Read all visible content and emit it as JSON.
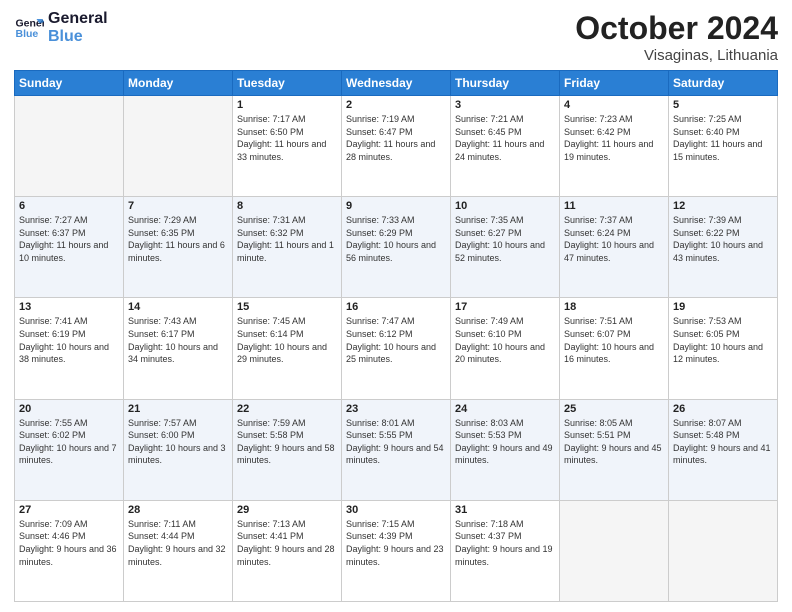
{
  "logo": {
    "line1": "General",
    "line2": "Blue"
  },
  "title": "October 2024",
  "location": "Visaginas, Lithuania",
  "days_header": [
    "Sunday",
    "Monday",
    "Tuesday",
    "Wednesday",
    "Thursday",
    "Friday",
    "Saturday"
  ],
  "weeks": [
    [
      {
        "num": "",
        "empty": true
      },
      {
        "num": "",
        "empty": true
      },
      {
        "num": "1",
        "sunrise": "Sunrise: 7:17 AM",
        "sunset": "Sunset: 6:50 PM",
        "daylight": "Daylight: 11 hours and 33 minutes."
      },
      {
        "num": "2",
        "sunrise": "Sunrise: 7:19 AM",
        "sunset": "Sunset: 6:47 PM",
        "daylight": "Daylight: 11 hours and 28 minutes."
      },
      {
        "num": "3",
        "sunrise": "Sunrise: 7:21 AM",
        "sunset": "Sunset: 6:45 PM",
        "daylight": "Daylight: 11 hours and 24 minutes."
      },
      {
        "num": "4",
        "sunrise": "Sunrise: 7:23 AM",
        "sunset": "Sunset: 6:42 PM",
        "daylight": "Daylight: 11 hours and 19 minutes."
      },
      {
        "num": "5",
        "sunrise": "Sunrise: 7:25 AM",
        "sunset": "Sunset: 6:40 PM",
        "daylight": "Daylight: 11 hours and 15 minutes."
      }
    ],
    [
      {
        "num": "6",
        "sunrise": "Sunrise: 7:27 AM",
        "sunset": "Sunset: 6:37 PM",
        "daylight": "Daylight: 11 hours and 10 minutes."
      },
      {
        "num": "7",
        "sunrise": "Sunrise: 7:29 AM",
        "sunset": "Sunset: 6:35 PM",
        "daylight": "Daylight: 11 hours and 6 minutes."
      },
      {
        "num": "8",
        "sunrise": "Sunrise: 7:31 AM",
        "sunset": "Sunset: 6:32 PM",
        "daylight": "Daylight: 11 hours and 1 minute."
      },
      {
        "num": "9",
        "sunrise": "Sunrise: 7:33 AM",
        "sunset": "Sunset: 6:29 PM",
        "daylight": "Daylight: 10 hours and 56 minutes."
      },
      {
        "num": "10",
        "sunrise": "Sunrise: 7:35 AM",
        "sunset": "Sunset: 6:27 PM",
        "daylight": "Daylight: 10 hours and 52 minutes."
      },
      {
        "num": "11",
        "sunrise": "Sunrise: 7:37 AM",
        "sunset": "Sunset: 6:24 PM",
        "daylight": "Daylight: 10 hours and 47 minutes."
      },
      {
        "num": "12",
        "sunrise": "Sunrise: 7:39 AM",
        "sunset": "Sunset: 6:22 PM",
        "daylight": "Daylight: 10 hours and 43 minutes."
      }
    ],
    [
      {
        "num": "13",
        "sunrise": "Sunrise: 7:41 AM",
        "sunset": "Sunset: 6:19 PM",
        "daylight": "Daylight: 10 hours and 38 minutes."
      },
      {
        "num": "14",
        "sunrise": "Sunrise: 7:43 AM",
        "sunset": "Sunset: 6:17 PM",
        "daylight": "Daylight: 10 hours and 34 minutes."
      },
      {
        "num": "15",
        "sunrise": "Sunrise: 7:45 AM",
        "sunset": "Sunset: 6:14 PM",
        "daylight": "Daylight: 10 hours and 29 minutes."
      },
      {
        "num": "16",
        "sunrise": "Sunrise: 7:47 AM",
        "sunset": "Sunset: 6:12 PM",
        "daylight": "Daylight: 10 hours and 25 minutes."
      },
      {
        "num": "17",
        "sunrise": "Sunrise: 7:49 AM",
        "sunset": "Sunset: 6:10 PM",
        "daylight": "Daylight: 10 hours and 20 minutes."
      },
      {
        "num": "18",
        "sunrise": "Sunrise: 7:51 AM",
        "sunset": "Sunset: 6:07 PM",
        "daylight": "Daylight: 10 hours and 16 minutes."
      },
      {
        "num": "19",
        "sunrise": "Sunrise: 7:53 AM",
        "sunset": "Sunset: 6:05 PM",
        "daylight": "Daylight: 10 hours and 12 minutes."
      }
    ],
    [
      {
        "num": "20",
        "sunrise": "Sunrise: 7:55 AM",
        "sunset": "Sunset: 6:02 PM",
        "daylight": "Daylight: 10 hours and 7 minutes."
      },
      {
        "num": "21",
        "sunrise": "Sunrise: 7:57 AM",
        "sunset": "Sunset: 6:00 PM",
        "daylight": "Daylight: 10 hours and 3 minutes."
      },
      {
        "num": "22",
        "sunrise": "Sunrise: 7:59 AM",
        "sunset": "Sunset: 5:58 PM",
        "daylight": "Daylight: 9 hours and 58 minutes."
      },
      {
        "num": "23",
        "sunrise": "Sunrise: 8:01 AM",
        "sunset": "Sunset: 5:55 PM",
        "daylight": "Daylight: 9 hours and 54 minutes."
      },
      {
        "num": "24",
        "sunrise": "Sunrise: 8:03 AM",
        "sunset": "Sunset: 5:53 PM",
        "daylight": "Daylight: 9 hours and 49 minutes."
      },
      {
        "num": "25",
        "sunrise": "Sunrise: 8:05 AM",
        "sunset": "Sunset: 5:51 PM",
        "daylight": "Daylight: 9 hours and 45 minutes."
      },
      {
        "num": "26",
        "sunrise": "Sunrise: 8:07 AM",
        "sunset": "Sunset: 5:48 PM",
        "daylight": "Daylight: 9 hours and 41 minutes."
      }
    ],
    [
      {
        "num": "27",
        "sunrise": "Sunrise: 7:09 AM",
        "sunset": "Sunset: 4:46 PM",
        "daylight": "Daylight: 9 hours and 36 minutes."
      },
      {
        "num": "28",
        "sunrise": "Sunrise: 7:11 AM",
        "sunset": "Sunset: 4:44 PM",
        "daylight": "Daylight: 9 hours and 32 minutes."
      },
      {
        "num": "29",
        "sunrise": "Sunrise: 7:13 AM",
        "sunset": "Sunset: 4:41 PM",
        "daylight": "Daylight: 9 hours and 28 minutes."
      },
      {
        "num": "30",
        "sunrise": "Sunrise: 7:15 AM",
        "sunset": "Sunset: 4:39 PM",
        "daylight": "Daylight: 9 hours and 23 minutes."
      },
      {
        "num": "31",
        "sunrise": "Sunrise: 7:18 AM",
        "sunset": "Sunset: 4:37 PM",
        "daylight": "Daylight: 9 hours and 19 minutes."
      },
      {
        "num": "",
        "empty": true
      },
      {
        "num": "",
        "empty": true
      }
    ]
  ]
}
